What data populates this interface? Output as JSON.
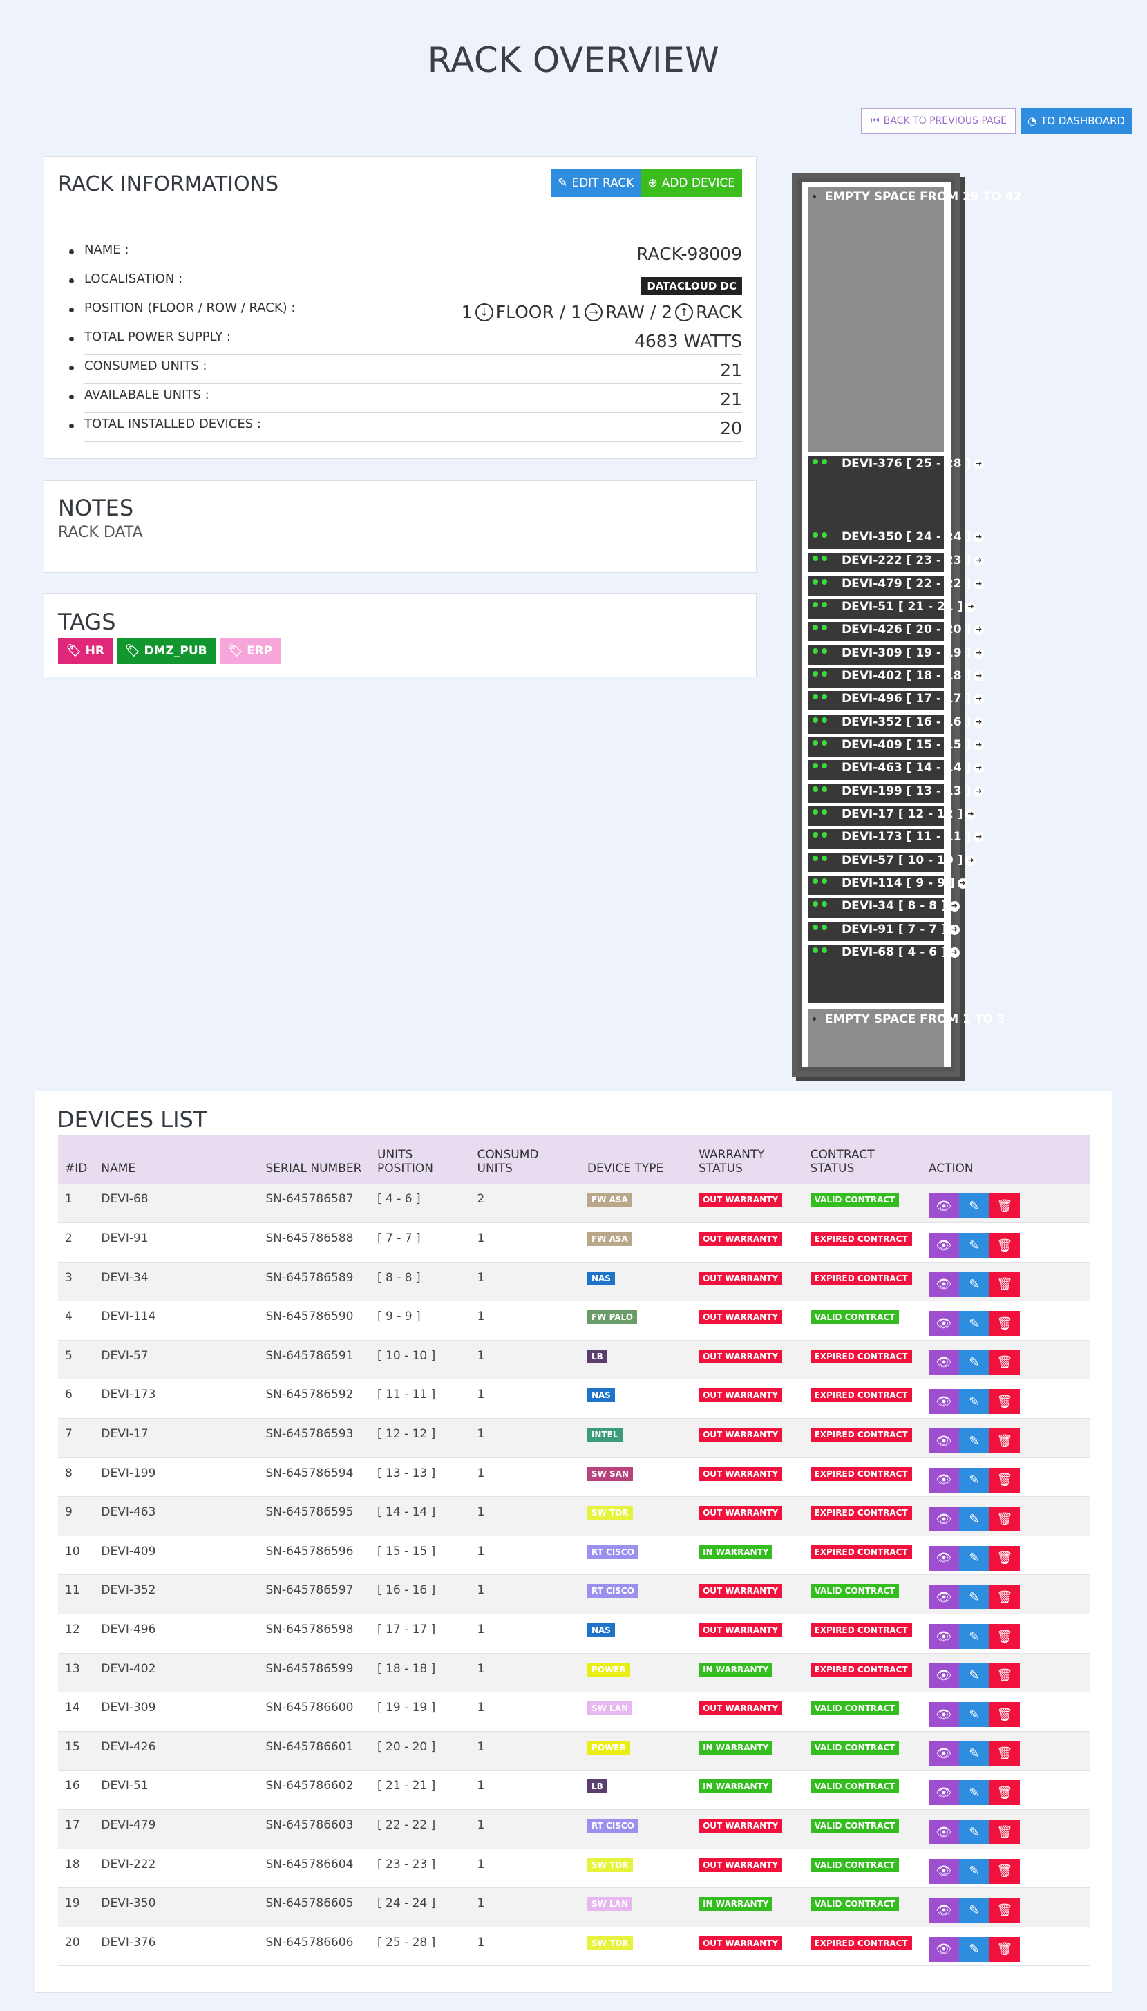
{
  "page": {
    "title": "RACK OVERVIEW"
  },
  "nav": {
    "back_label": "BACK TO PREVIOUS PAGE",
    "dashboard_label": "TO DASHBOARD"
  },
  "rack_info": {
    "title": "RACK INFORMATIONS",
    "edit_label": "EDIT RACK",
    "add_label": "ADD DEVICE",
    "name_label": "NAME :",
    "name_value": "RACK-98009",
    "loc_label": "LOCALISATION :",
    "loc_value": "DATACLOUD DC",
    "pos_label": "POSITION (FLOOR / ROW / RACK) :",
    "pos_floor_num": "1",
    "pos_floor": "FLOOR / 1",
    "pos_row": "RAW / 2",
    "pos_rack": "RACK",
    "power_label": "TOTAL POWER SUPPLY :",
    "power_value": "4683 WATTS",
    "consumed_label": "CONSUMED UNITS :",
    "consumed_value": "21",
    "available_label": "AVAILABALE UNITS :",
    "available_value": "21",
    "installed_label": "TOTAL INSTALLED DEVICES :",
    "installed_value": "20"
  },
  "notes": {
    "title": "NOTES",
    "text": "RACK DATA"
  },
  "tags": {
    "title": "TAGS",
    "items": [
      {
        "label": "HR",
        "color": "#e0287a"
      },
      {
        "label": "DMZ_PUB",
        "color": "#12962e"
      },
      {
        "label": "ERP",
        "color": "#f6a6da"
      }
    ]
  },
  "rack": {
    "empty_top": "EMPTY SPACE FROM 29 TO 42",
    "empty_bottom": "EMPTY SPACE FROM 1 TO 3",
    "slots": [
      "DEVI-376 [ 25 - 28 ]",
      "DEVI-350 [ 24 - 24 ]",
      "DEVI-222 [ 23 - 23 ]",
      "DEVI-479 [ 22 - 22 ]",
      "DEVI-51 [ 21 - 21 ]",
      "DEVI-426 [ 20 - 20 ]",
      "DEVI-309 [ 19 - 19 ]",
      "DEVI-402 [ 18 - 18 ]",
      "DEVI-496 [ 17 - 17 ]",
      "DEVI-352 [ 16 - 16 ]",
      "DEVI-409 [ 15 - 15 ]",
      "DEVI-463 [ 14 - 14 ]",
      "DEVI-199 [ 13 - 13 ]",
      "DEVI-17 [ 12 - 12 ]",
      "DEVI-173 [ 11 - 11 ]",
      "DEVI-57 [ 10 - 10 ]",
      "DEVI-114 [ 9 - 9 ]",
      "DEVI-34 [ 8 - 8 ]",
      "DEVI-91 [ 7 - 7 ]",
      "DEVI-68 [ 4 - 6 ]"
    ]
  },
  "devices": {
    "title": "DEVICES LIST",
    "headers": [
      "#ID",
      "NAME",
      "SERIAL NUMBER",
      "UNITS POSITION",
      "CONSUMD UNITS",
      "DEVICE TYPE",
      "WARRANTY STATUS",
      "CONTRACT STATUS",
      "ACTION"
    ],
    "rows": [
      [
        "1",
        "DEVI-68",
        "SN-645786587",
        "[ 4 - 6 ]",
        "2",
        "FW ASA",
        "OUT WARRANTY",
        "VALID CONTRACT"
      ],
      [
        "2",
        "DEVI-91",
        "SN-645786588",
        "[ 7 - 7 ]",
        "1",
        "FW ASA",
        "OUT WARRANTY",
        "EXPIRED CONTRACT"
      ],
      [
        "3",
        "DEVI-34",
        "SN-645786589",
        "[ 8 - 8 ]",
        "1",
        "NAS",
        "OUT WARRANTY",
        "EXPIRED CONTRACT"
      ],
      [
        "4",
        "DEVI-114",
        "SN-645786590",
        "[ 9 - 9 ]",
        "1",
        "FW PALO",
        "OUT WARRANTY",
        "VALID CONTRACT"
      ],
      [
        "5",
        "DEVI-57",
        "SN-645786591",
        "[ 10 - 10 ]",
        "1",
        "LB",
        "OUT WARRANTY",
        "EXPIRED CONTRACT"
      ],
      [
        "6",
        "DEVI-173",
        "SN-645786592",
        "[ 11 - 11 ]",
        "1",
        "NAS",
        "OUT WARRANTY",
        "EXPIRED CONTRACT"
      ],
      [
        "7",
        "DEVI-17",
        "SN-645786593",
        "[ 12 - 12 ]",
        "1",
        "INTEL",
        "OUT WARRANTY",
        "EXPIRED CONTRACT"
      ],
      [
        "8",
        "DEVI-199",
        "SN-645786594",
        "[ 13 - 13 ]",
        "1",
        "SW SAN",
        "OUT WARRANTY",
        "EXPIRED CONTRACT"
      ],
      [
        "9",
        "DEVI-463",
        "SN-645786595",
        "[ 14 - 14 ]",
        "1",
        "SW TOR",
        "OUT WARRANTY",
        "EXPIRED CONTRACT"
      ],
      [
        "10",
        "DEVI-409",
        "SN-645786596",
        "[ 15 - 15 ]",
        "1",
        "RT CISCO",
        "IN WARRANTY",
        "EXPIRED CONTRACT"
      ],
      [
        "11",
        "DEVI-352",
        "SN-645786597",
        "[ 16 - 16 ]",
        "1",
        "RT CISCO",
        "OUT WARRANTY",
        "VALID CONTRACT"
      ],
      [
        "12",
        "DEVI-496",
        "SN-645786598",
        "[ 17 - 17 ]",
        "1",
        "NAS",
        "OUT WARRANTY",
        "EXPIRED CONTRACT"
      ],
      [
        "13",
        "DEVI-402",
        "SN-645786599",
        "[ 18 - 18 ]",
        "1",
        "POWER",
        "IN WARRANTY",
        "EXPIRED CONTRACT"
      ],
      [
        "14",
        "DEVI-309",
        "SN-645786600",
        "[ 19 - 19 ]",
        "1",
        "SW LAN",
        "OUT WARRANTY",
        "VALID CONTRACT"
      ],
      [
        "15",
        "DEVI-426",
        "SN-645786601",
        "[ 20 - 20 ]",
        "1",
        "POWER",
        "IN WARRANTY",
        "VALID CONTRACT"
      ],
      [
        "16",
        "DEVI-51",
        "SN-645786602",
        "[ 21 - 21 ]",
        "1",
        "LB",
        "IN WARRANTY",
        "VALID CONTRACT"
      ],
      [
        "17",
        "DEVI-479",
        "SN-645786603",
        "[ 22 - 22 ]",
        "1",
        "RT CISCO",
        "OUT WARRANTY",
        "VALID CONTRACT"
      ],
      [
        "18",
        "DEVI-222",
        "SN-645786604",
        "[ 23 - 23 ]",
        "1",
        "SW TOR",
        "OUT WARRANTY",
        "VALID CONTRACT"
      ],
      [
        "19",
        "DEVI-350",
        "SN-645786605",
        "[ 24 - 24 ]",
        "1",
        "SW LAN",
        "IN WARRANTY",
        "VALID CONTRACT"
      ],
      [
        "20",
        "DEVI-376",
        "SN-645786606",
        "[ 25 - 28 ]",
        "1",
        "SW TOR",
        "OUT WARRANTY",
        "EXPIRED CONTRACT"
      ]
    ],
    "type_colors": {
      "FW ASA": "#b8a889",
      "NAS": "#1f74c9",
      "FW PALO": "#6a9c6a",
      "LB": "#5a3f6e",
      "INTEL": "#3b9b7a",
      "SW SAN": "#b8437d",
      "SW TOR": "#e6f23c",
      "RT CISCO": "#9b8ff0",
      "POWER": "#e8ee16",
      "SW LAN": "#e7b8f0"
    },
    "status_colors": {
      "OUT WARRANTY": "#f0123c",
      "IN WARRANTY": "#33bd1e",
      "VALID CONTRACT": "#33bd1e",
      "EXPIRED CONTRACT": "#f0123c"
    }
  }
}
